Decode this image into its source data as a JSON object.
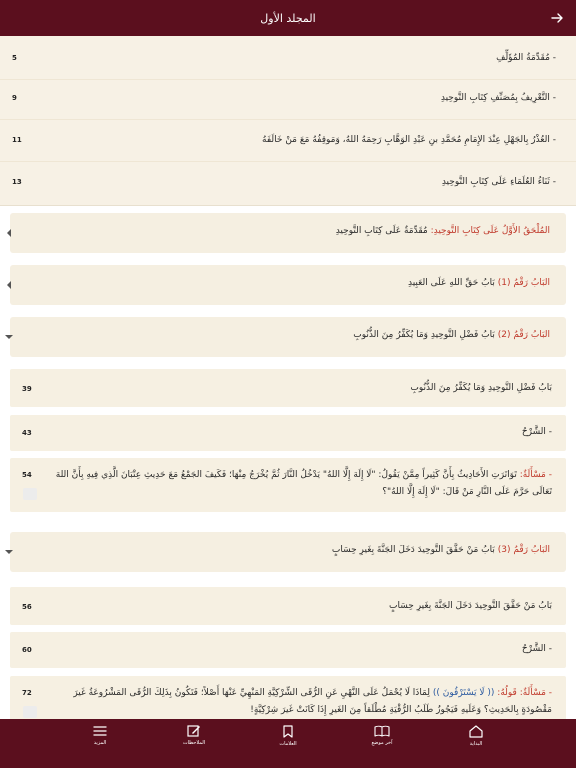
{
  "header": {
    "title": "المجلد الأول"
  },
  "top_rows": [
    {
      "text": "- مُقَدِّمَةُ المُؤَلِّفِ",
      "page": "5"
    },
    {
      "text": "- التَّعْرِيفُ بِمُصَنِّفِ كِتَابِ التَّوحِيدِ",
      "page": "9"
    },
    {
      "text": "- العُذْرُ بِالجَهْلِ عِنْدَ الإِمَامِ مُحَمَّدِ بنِ عَبْدِ الوَهَّابِ رَحِمَهُ اللهُ، وَمَوقِفُهُ مَعَ مَنْ خَالَفَهُ",
      "page": "11"
    },
    {
      "text": "- ثَنَاءُ العُلَمَاءِ عَلَى كِتَابِ التَّوحِيدِ",
      "page": "13"
    }
  ],
  "chapters": {
    "appendix": {
      "red": "المُلْحَقُ الأَوَّلُ عَلَى كِتَابِ التَّوحِيدِ:",
      "text": " مُقَدِّمَةٌ عَلَى كِتَابِ التَّوحِيدِ"
    },
    "ch1": {
      "red": "البَابُ رَقْمُ (1)",
      "text": " بَابُ حَقِّ اللهِ عَلَى العَبِيدِ"
    },
    "ch2": {
      "red": "البَابُ رَقْمُ (2)",
      "text": " بَابُ فَضْلِ التَّوحِيدِ وَمَا يُكَفِّرُ مِنَ الذُّنُوبِ",
      "items": [
        {
          "text": "بَابُ فَضْلِ التَّوحِيدِ وَمَا يُكَفِّرُ مِنَ الذُّنُوبِ",
          "page": "39"
        },
        {
          "text": "- الشَّرْحُ",
          "page": "43"
        },
        {
          "red": "- مَسْأَلَةٌ:",
          "text": " تَوَاتَرَتِ الأَحَادِيثُ بِأَنَّ كَثِيراً مِمَّنْ يَقُولُ: \"لَا إِلَهَ إِلَّا اللهُ\" يَدْخُلُ النَّارَ ثُمَّ يُخْرَجُ مِنْهَا؛ فَكَيفَ الجَمْعُ مَعَ حَدِيثِ عِتْبَانَ الَّذِي فِيهِ بِأَنَّ اللهَ تَعَالَى حَرَّمَ عَلَى النَّارِ مَنْ قَالَ: \"لَا إِلَهَ إِلَّا اللهُ\"؟",
          "page": "54"
        }
      ]
    },
    "ch3": {
      "red": "البَابُ رَقْمُ (3)",
      "text": " بَابُ مَنْ حَقَّقَ التَّوحِيدَ دَخَلَ الجَنَّةَ بِغَيرِ حِسَابٍ",
      "items": [
        {
          "text": "بَابُ مَنْ حَقَّقَ التَّوحِيدَ دَخَلَ الجَنَّةَ بِغَيرِ حِسَابٍ",
          "page": "56"
        },
        {
          "text": "- الشَّرْحُ",
          "page": "60"
        },
        {
          "red": "- مَسْأَلَةٌ: قَولُهُ:",
          "blue": " (( لَا يَسْتَرْقُونَ )) ",
          "text": "لِمَاذَا لَا يُحْمَلُ عَلَى النَّهْيِ عَنِ الرُّقَى الشِّرْكِيَّةِ المَنْهِيِّ عَنْهَا أَصْلاً؛ فَتَكُونُ بِذَلِكَ الرُّقَى المَشْرُوعَةُ غَيرَ مَقْصُودَةٍ بِالحَدِيثِ؟ وَعَلَيهِ فَيَجُوزُ طَلَبُ الرُّقْيَةِ مُطْلَقاً مِنَ الغَيرِ إِذَا كَانَتْ غَيرَ شِرْكِيَّةٍ!",
          "page": "72"
        }
      ]
    }
  },
  "bottom_nav": [
    {
      "label": "المزيد",
      "icon": "menu-icon"
    },
    {
      "label": "الملاحظات",
      "icon": "note-edit-icon"
    },
    {
      "label": "العلامات",
      "icon": "bookmark-icon"
    },
    {
      "label": "آخر موضع",
      "icon": "open-book-icon"
    },
    {
      "label": "البداية",
      "icon": "home-icon"
    }
  ],
  "colors": {
    "brand": "#5b0f1e",
    "accent_red": "#c0392b",
    "row_bg": "#f7f1e5"
  }
}
